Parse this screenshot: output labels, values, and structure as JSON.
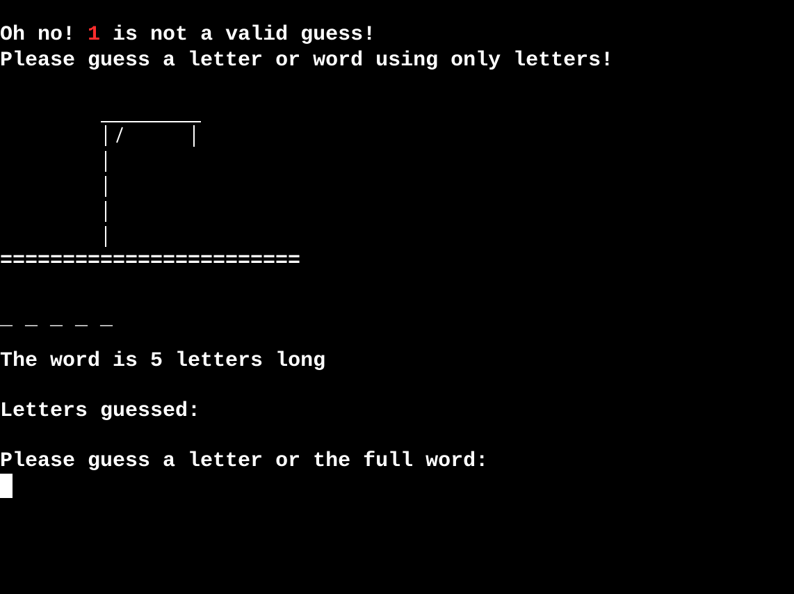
{
  "terminal": {
    "error_prefix": "Oh no! ",
    "invalid_guess": "1",
    "error_suffix": " is not a valid guess!",
    "error_help": "Please guess a letter or word using only letters!",
    "gallows_base": "========================",
    "word_blanks": "_ _ _ _ _",
    "length_message": "The word is 5 letters long",
    "letters_guessed_label": "Letters guessed:",
    "input_prompt": "Please guess a letter or the full word:",
    "colors": {
      "background": "#000000",
      "text": "#ffffff",
      "error_highlight": "#ff2d2d"
    }
  }
}
